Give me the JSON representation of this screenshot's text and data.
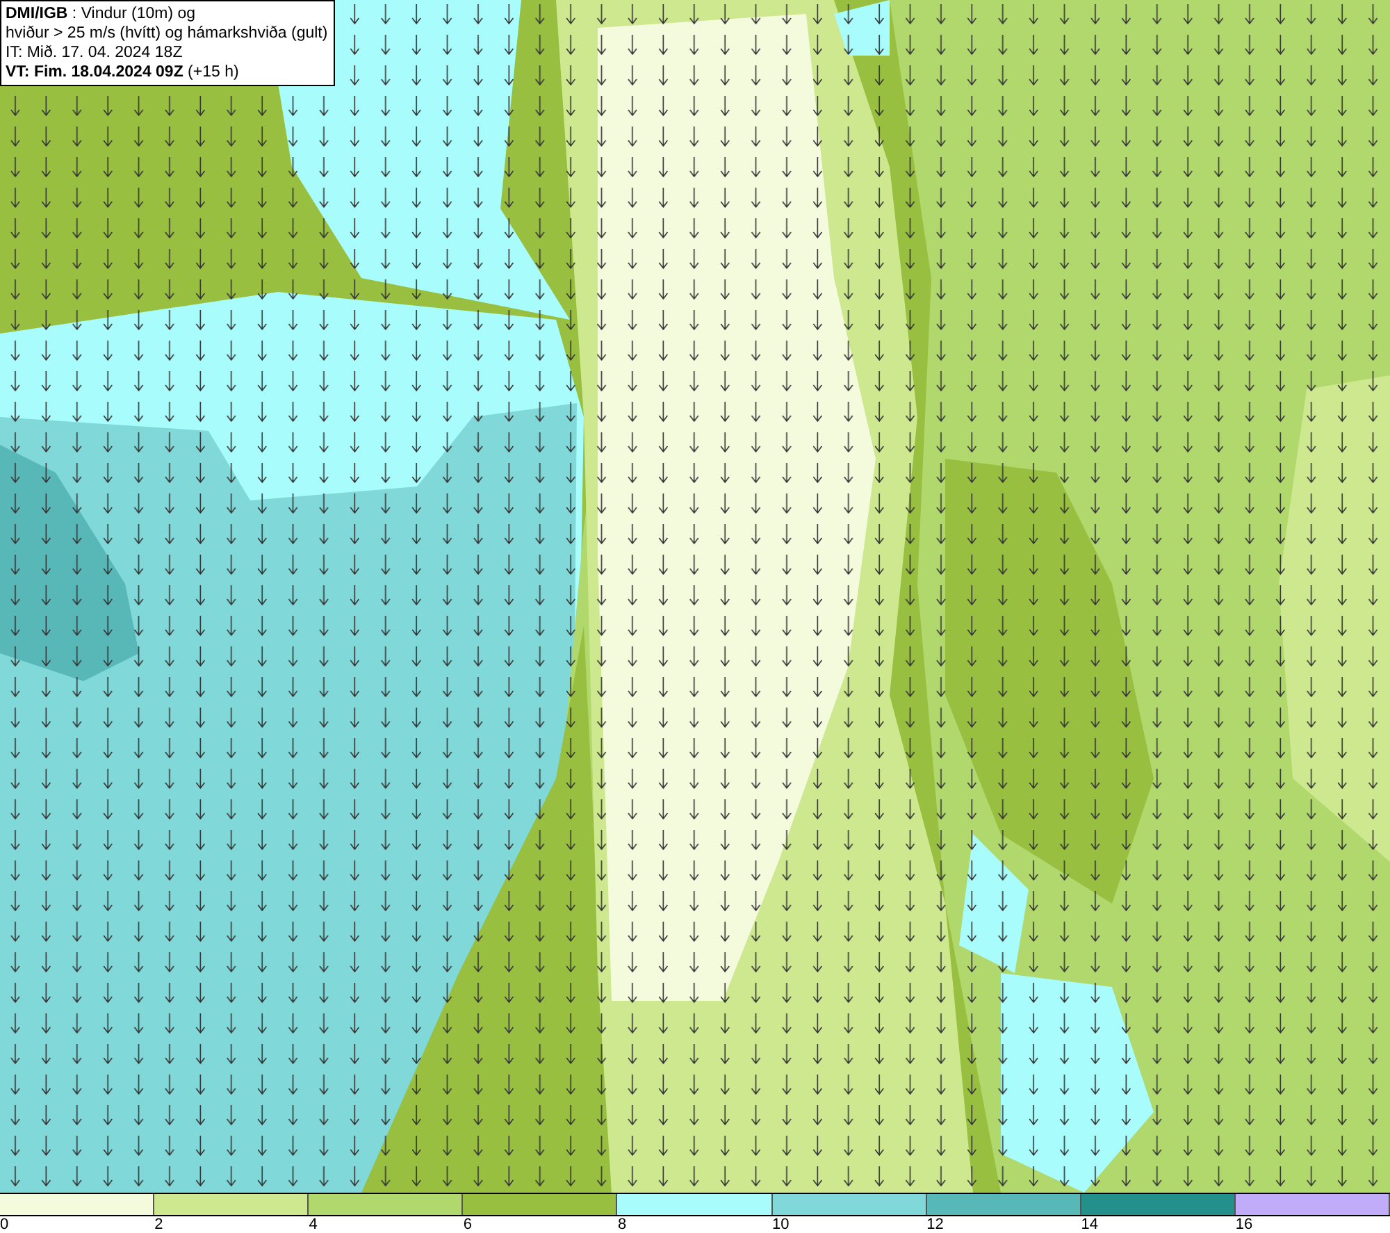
{
  "title_box": {
    "lines": [
      "**DMI/IGB** : Vindur (10m) og",
      "hviður > 25 m/s (hvítt) og hámarkshviða (gult)",
      "IT: Mið. 17. 04. 2024 18Z",
      "**VT: Fim. 18.04.2024 09Z** (+15 h)"
    ]
  },
  "legend": {
    "bins": [
      {
        "color": "#f4fadc"
      },
      {
        "color": "#cde88e"
      },
      {
        "color": "#b0d86c"
      },
      {
        "color": "#98bf40"
      },
      {
        "color": "#a8fcfc"
      },
      {
        "color": "#80d8d8"
      },
      {
        "color": "#58b8b8"
      },
      {
        "color": "#24908c"
      },
      {
        "color": "#c0acf8"
      }
    ],
    "ticks": [
      "0",
      "2",
      "4",
      "6",
      "8",
      "10",
      "12",
      "14",
      "16"
    ]
  }
}
